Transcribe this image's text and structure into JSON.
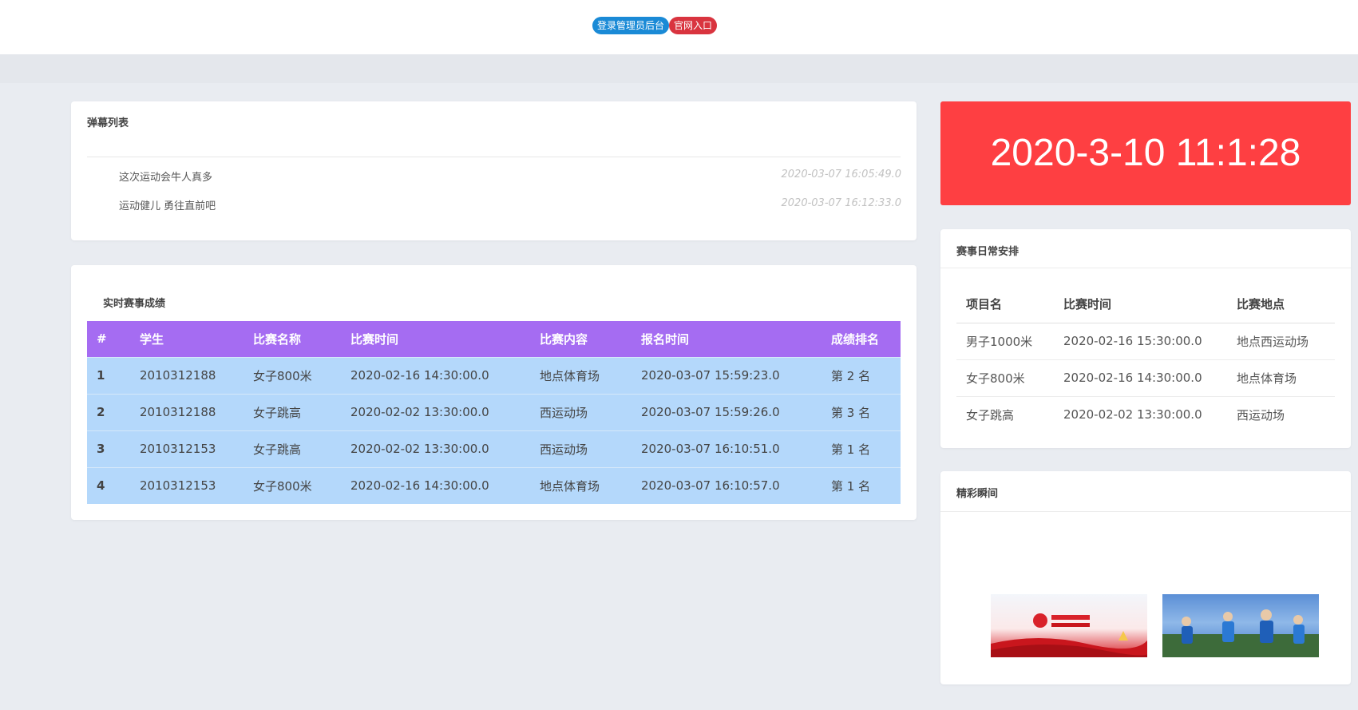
{
  "topbar": {
    "admin_button": "登录管理员后台",
    "site_button": "官网入口"
  },
  "danmu": {
    "title": "弹幕列表",
    "items": [
      {
        "text": "这次运动会牛人真多",
        "time": "2020-03-07 16:05:49.0"
      },
      {
        "text": "运动健儿 勇往直前吧",
        "time": "2020-03-07 16:12:33.0"
      }
    ]
  },
  "results": {
    "title": "实时赛事成绩",
    "headers": [
      "#",
      "学生",
      "比赛名称",
      "比赛时间",
      "比赛内容",
      "报名时间",
      "成绩排名"
    ],
    "rows": [
      [
        "1",
        "2010312188",
        "女子800米",
        "2020-02-16 14:30:00.0",
        "地点体育场",
        "2020-03-07 15:59:23.0",
        "第 2 名"
      ],
      [
        "2",
        "2010312188",
        "女子跳高",
        "2020-02-02 13:30:00.0",
        "西运动场",
        "2020-03-07 15:59:26.0",
        "第 3 名"
      ],
      [
        "3",
        "2010312153",
        "女子跳高",
        "2020-02-02 13:30:00.0",
        "西运动场",
        "2020-03-07 16:10:51.0",
        "第 1 名"
      ],
      [
        "4",
        "2010312153",
        "女子800米",
        "2020-02-16 14:30:00.0",
        "地点体育场",
        "2020-03-07 16:10:57.0",
        "第 1 名"
      ]
    ]
  },
  "clock": {
    "text": "2020-3-10 11:1:28",
    "bg_color": "#fe3f42"
  },
  "schedule": {
    "title": "赛事日常安排",
    "headers": [
      "项目名",
      "比赛时间",
      "比赛地点"
    ],
    "rows": [
      [
        "男子1000米",
        "2020-02-16 15:30:00.0",
        "地点西运动场"
      ],
      [
        "女子800米",
        "2020-02-16 14:30:00.0",
        "地点体育场"
      ],
      [
        "女子跳高",
        "2020-02-02 13:30:00.0",
        "西运动场"
      ]
    ]
  },
  "highlights": {
    "title": "精彩瞬间"
  },
  "colors": {
    "admin_blue": "#1a8ad6",
    "site_red": "#d9343f",
    "table_header": "#a56cf2",
    "table_row": "#b4d8fb"
  }
}
